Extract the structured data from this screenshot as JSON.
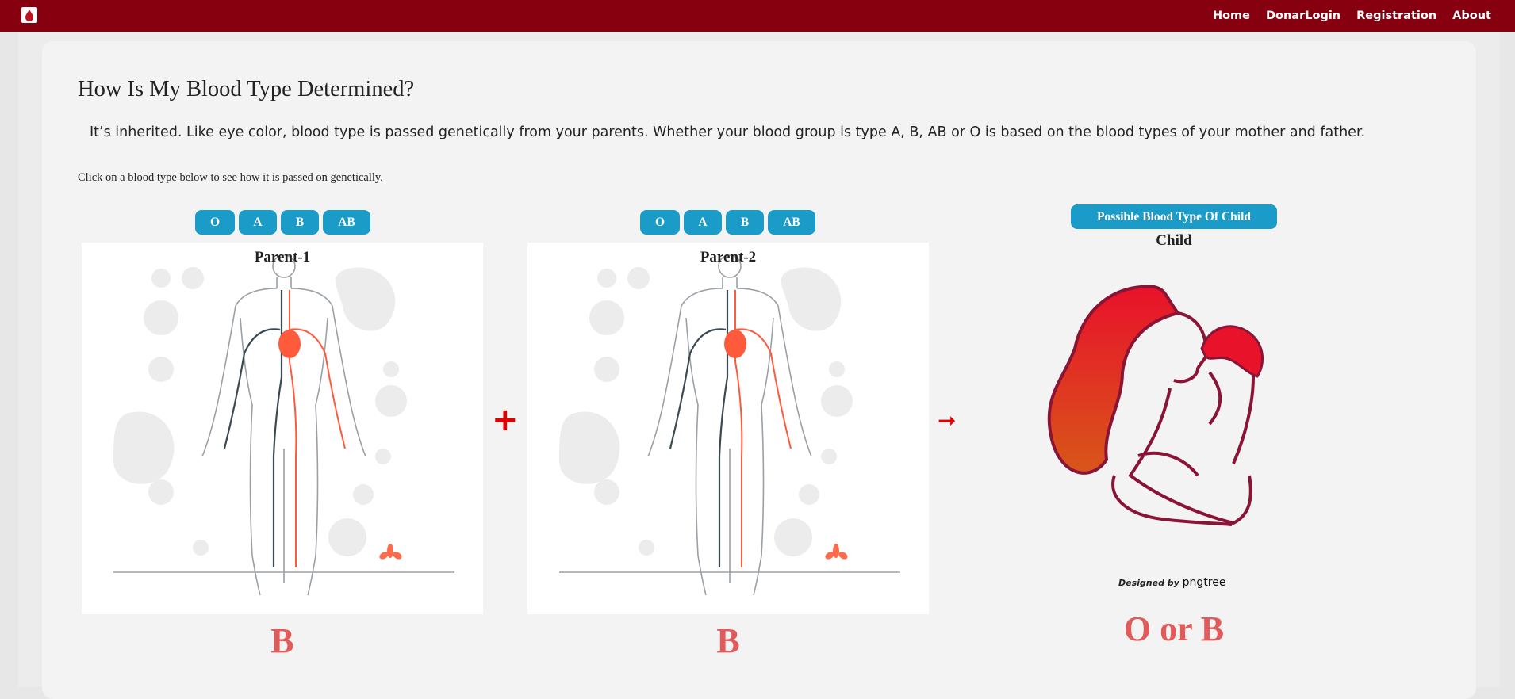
{
  "nav": {
    "logo_icon": "blood-drop-logo",
    "links": [
      "Home",
      "DonarLogin",
      "Registration",
      "About"
    ]
  },
  "page": {
    "title": "How Is My Blood Type Determined?",
    "intro": "It’s inherited. Like eye color, blood type is passed genetically from your parents. Whether your blood group is type A, B, AB or O is based on the blood types of your mother and father.",
    "hint": "Click on a blood type below to see how it is passed on genetically."
  },
  "blood_types": [
    "O",
    "A",
    "B",
    "AB"
  ],
  "parent1": {
    "label": "Parent-1",
    "selected": "B"
  },
  "parent2": {
    "label": "Parent-2",
    "selected": "B"
  },
  "operators": {
    "plus": "+",
    "arrow": "➞"
  },
  "child": {
    "button_label": "Possible Blood Type Of Child",
    "label": "Child",
    "result": "O or B",
    "credit_prefix": "Designed by",
    "credit_brand": "pngtree"
  },
  "colors": {
    "navbar": "#86000f",
    "button": "#1b9bc8",
    "result": "#e15b5b",
    "operator": "#e10000"
  }
}
